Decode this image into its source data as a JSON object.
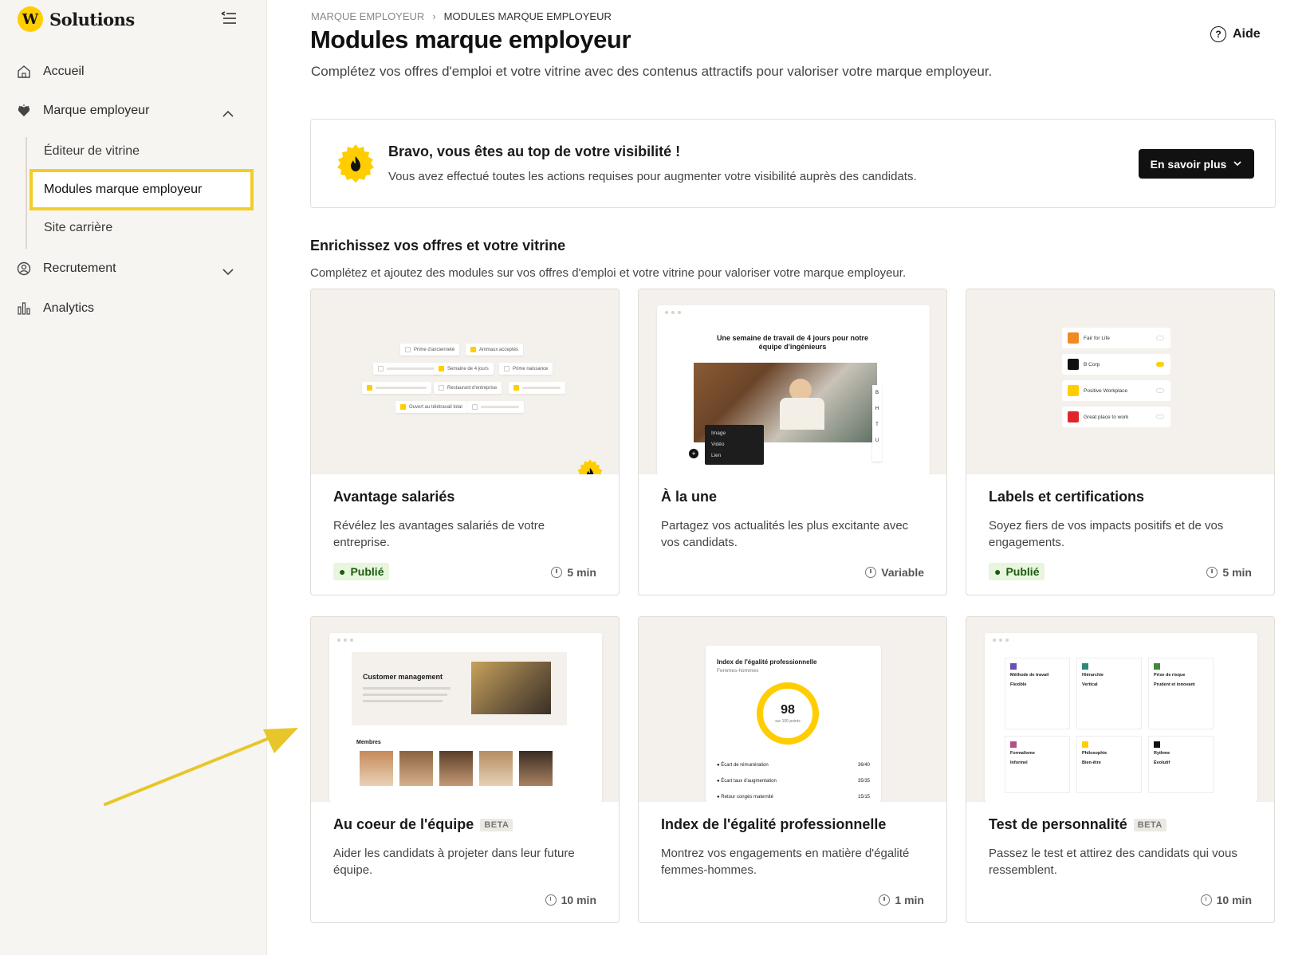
{
  "sidebar": {
    "brand": "Solutions",
    "brand_mark": "W",
    "nav": [
      {
        "label": "Accueil",
        "icon": "home-icon"
      },
      {
        "label": "Marque employeur",
        "icon": "heart-icon",
        "expanded": true,
        "children": [
          "Éditeur de vitrine",
          "Modules marque employeur",
          "Site carrière"
        ]
      },
      {
        "label": "Recrutement",
        "icon": "person-search-icon",
        "expanded": false
      },
      {
        "label": "Analytics",
        "icon": "analytics-icon"
      }
    ]
  },
  "header": {
    "breadcrumb": [
      "MARQUE EMPLOYEUR",
      "MODULES MARQUE EMPLOYEUR"
    ],
    "title": "Modules marque employeur",
    "subtitle": "Complétez vos offres d'emploi et votre vitrine avec des contenus attractifs pour valoriser votre marque employeur.",
    "help": "Aide"
  },
  "banner": {
    "title": "Bravo, vous êtes au top de votre visibilité !",
    "text": "Vous avez effectué toutes les actions requises pour augmenter votre visibilité auprès des candidats.",
    "button": "En savoir plus"
  },
  "section": {
    "title": "Enrichissez vos offres et votre vitrine",
    "subtitle": "Complétez et ajoutez des modules sur vos offres d'emploi et votre vitrine pour valoriser votre marque employeur."
  },
  "cards": [
    {
      "title": "Avantage salariés",
      "desc": "Révélez les avantages salariés de votre entreprise.",
      "status": "Publié",
      "duration": "5 min"
    },
    {
      "title": "À la une",
      "desc": "Partagez vos actualités les plus excitante avec vos candidats.",
      "status": "",
      "duration": "Variable"
    },
    {
      "title": "Labels et certifications",
      "desc": "Soyez fiers de vos impacts positifs et de vos engagements.",
      "status": "Publié",
      "duration": "5 min"
    },
    {
      "title": "Au coeur de l'équipe",
      "beta": "BETA",
      "desc": "Aider les candidats à projeter dans leur future équipe.",
      "duration": "10 min"
    },
    {
      "title": "Index de l'égalité professionnelle",
      "desc": "Montrez vos engagements en matière d'égalité femmes-hommes.",
      "duration": "1 min"
    },
    {
      "title": "Test de personnalité",
      "beta": "BETA",
      "desc": "Passez le test et attirez des candidats qui vous ressemblent.",
      "duration": "10 min"
    }
  ],
  "thumbs": {
    "perks": [
      "Prime d'ancienneté",
      "Animaux acceptés",
      "Semaine de 4 jours",
      "Prime naissance",
      "Restaurant d'entreprise",
      "Ouvert au télétravail total"
    ],
    "news_title": "Une semaine de travail de 4 jours pour notre équipe d'ingénieurs",
    "news_menu": [
      "Image",
      "Vidéo",
      "Lien"
    ],
    "news_toolbar": [
      "B",
      "H",
      "T",
      "U"
    ],
    "labels": [
      "Fair for Life",
      "B Corp",
      "Positive Workplace",
      "Great place to work"
    ],
    "team_title": "Customer management",
    "team_members": "Membres",
    "index_title": "Index de l'égalité professionnelle",
    "index_sub": "Femmes-hommes",
    "index_score": "98",
    "index_score_sub": "sur 100 points",
    "index_rows": [
      {
        "label": "Écart de rémunération",
        "value": "36/40"
      },
      {
        "label": "Écart taux d'augmentation",
        "value": "35/35"
      },
      {
        "label": "Retour congés maternité",
        "value": "15/15"
      }
    ],
    "personality": [
      {
        "cat": "Méthode de travail",
        "val": "Flexible"
      },
      {
        "cat": "Hiérarchie",
        "val": "Vertical"
      },
      {
        "cat": "Prise de risque",
        "val": "Prudent et innovant"
      },
      {
        "cat": "Formalisme",
        "val": "Informel"
      },
      {
        "cat": "Philosophie",
        "val": "Bien-être"
      },
      {
        "cat": "Rythme",
        "val": "Évolutif"
      }
    ]
  },
  "colors": {
    "accent": "#ffcd00",
    "highlight_border": "#f2cc2a",
    "published_bg": "#e7f6dc"
  }
}
